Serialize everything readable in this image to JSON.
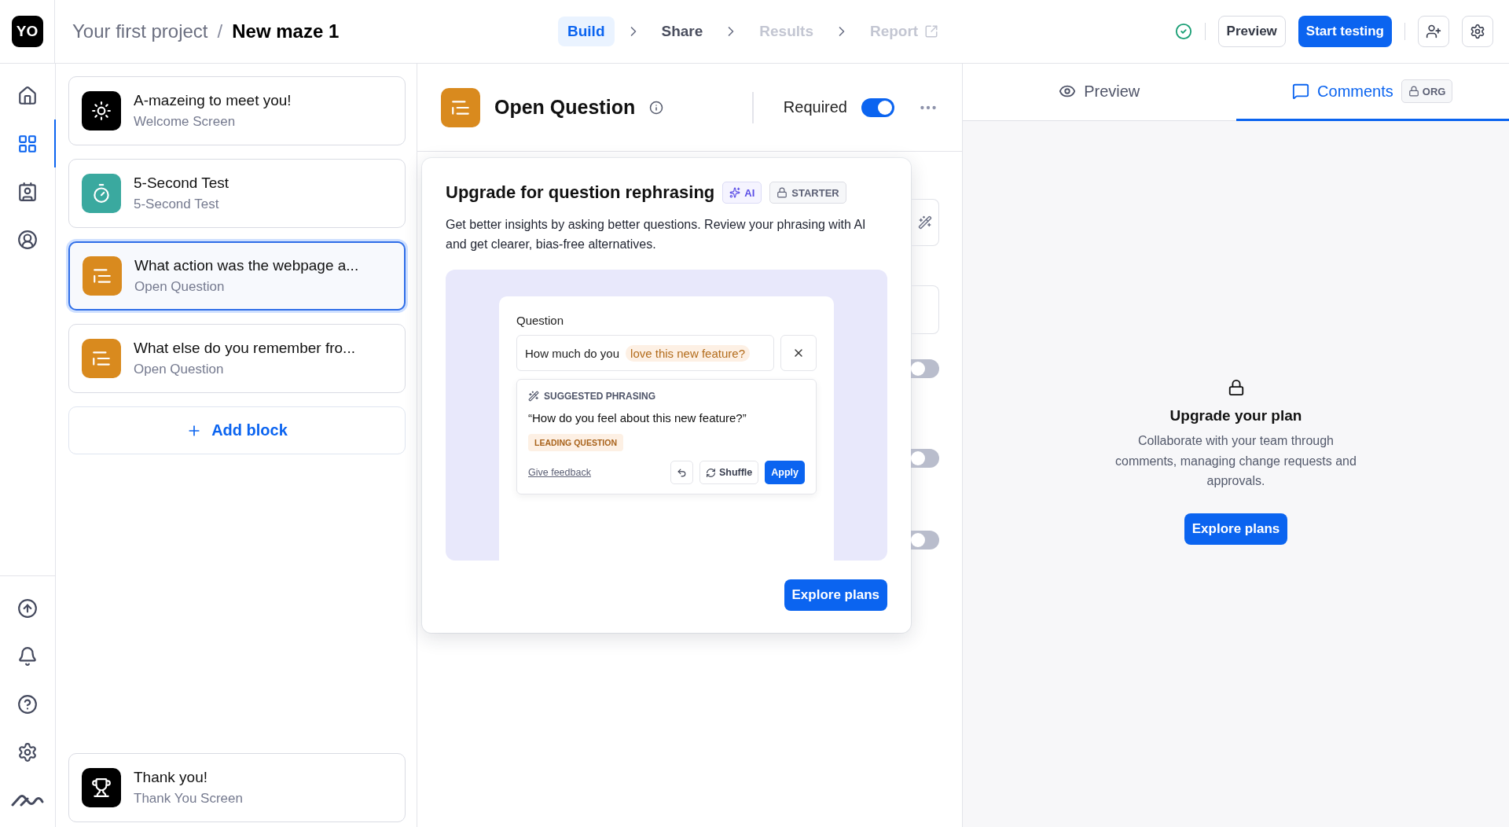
{
  "topbar": {
    "logo": "YO",
    "project": "Your first project",
    "separator": "/",
    "maze": "New maze 1",
    "steps": [
      {
        "label": "Build",
        "selected": true,
        "disabled": false
      },
      {
        "label": "Share",
        "selected": false,
        "disabled": false
      },
      {
        "label": "Results",
        "selected": false,
        "disabled": true
      },
      {
        "label": "Report",
        "selected": false,
        "disabled": true,
        "external": true
      }
    ],
    "preview_button": "Preview",
    "start_button": "Start testing"
  },
  "rail": {
    "top_items": [
      {
        "selected": false
      },
      {
        "selected": true
      },
      {
        "selected": false
      },
      {
        "selected": false
      }
    ],
    "bottom_items": [
      {
        "selected": false
      },
      {
        "selected": false
      },
      {
        "selected": false
      },
      {
        "selected": false
      },
      {
        "selected": false
      }
    ]
  },
  "blocks": [
    {
      "kind": "welcome",
      "title": "A-mazeing to meet you!",
      "subtitle": "Welcome Screen",
      "selected": false
    },
    {
      "kind": "five_second",
      "title": "5-Second Test",
      "subtitle": "5-Second Test",
      "selected": false
    },
    {
      "kind": "open_question",
      "title": "What action was the webpage a...",
      "subtitle": "Open Question",
      "selected": true
    },
    {
      "kind": "open_question",
      "title": "What else do you remember fro...",
      "subtitle": "Open Question",
      "selected": false
    }
  ],
  "add_block": "Add block",
  "end_block": {
    "kind": "thank_you",
    "title": "Thank you!",
    "subtitle": "Thank You Screen",
    "selected": false
  },
  "editor": {
    "kind": "open_question",
    "title": "Open Question",
    "required_label": "Required",
    "required": true,
    "hidden_toggles": [
      {
        "on": false
      },
      {
        "on": false
      },
      {
        "on": false
      }
    ]
  },
  "upgrade_popup": {
    "title": "Upgrade for question rephrasing",
    "ai_badge": "AI",
    "plan_badge": "STARTER",
    "description": "Get better insights by asking better questions. Review your phrasing with AI and get clearer, bias-free alternatives.",
    "illustration": {
      "field_label": "Question",
      "question_prefix": "How much do you",
      "question_highlight": "love this new feature?",
      "suggestion_heading": "SUGGESTED PHRASING",
      "suggestion": "“How do you feel about this new feature?”",
      "tag": "LEADING QUESTION",
      "feedback_link": "Give feedback",
      "shuffle_button": "Shuffle",
      "apply_button": "Apply"
    },
    "button": "Explore plans"
  },
  "side_panel": {
    "tabs": [
      {
        "label": "Preview",
        "selected": false
      },
      {
        "label": "Comments",
        "selected": true,
        "badge": "ORG"
      }
    ],
    "title": "Upgrade your plan",
    "description": "Collaborate with your team through comments, managing change requests and approvals.",
    "button": "Explore plans"
  }
}
